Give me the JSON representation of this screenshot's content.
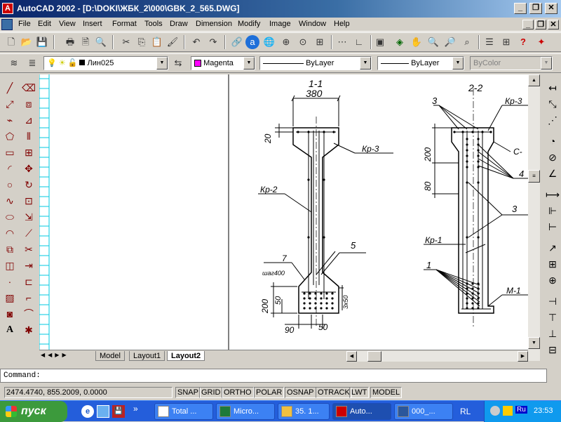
{
  "window": {
    "title": "AutoCAD 2002 - [D:\\DOKI\\ЖБК_2\\000\\GBK_2_565.DWG]",
    "min": "_",
    "restore": "❐",
    "close": "✕"
  },
  "menu": [
    "File",
    "Edit",
    "View",
    "Insert",
    "Format",
    "Tools",
    "Draw",
    "Dimension",
    "Modify",
    "Image",
    "Window",
    "Help"
  ],
  "props": {
    "layer": "Лин025",
    "color": "Magenta",
    "color_hex": "#ff00ff",
    "linetype": "ByLayer",
    "lineweight": "ByLayer",
    "plotstyle": "ByColor"
  },
  "tabs": [
    "Model",
    "Layout1",
    "Layout2"
  ],
  "active_tab": "Layout2",
  "command": "Command:",
  "coords": "2474.4740, 855.2009, 0.0000",
  "status_buttons": [
    "SNAP",
    "GRID",
    "ORTHO",
    "POLAR",
    "OSNAP",
    "OTRACK",
    "LWT",
    "MODEL"
  ],
  "drawing": {
    "sec1": {
      "title": "1-1",
      "dims": [
        "380",
        "20",
        "90",
        "50",
        "200",
        "50",
        "3x50"
      ],
      "labels": [
        "Кр-3",
        "Кр-2",
        "7",
        "5",
        "шаг400"
      ]
    },
    "sec2": {
      "title": "2-2",
      "dims": [
        "200",
        "80"
      ],
      "labels": [
        "3",
        "Кр-3",
        "С-",
        "4",
        "3",
        "Кр-1",
        "1",
        "М-1"
      ]
    }
  },
  "taskbar": {
    "start": "пуск",
    "tasks": [
      "Total ...",
      "Micro...",
      "35. 1...",
      "Auto...",
      "000_..."
    ],
    "lang_rl": "RL",
    "lang": "Ru",
    "clock": "23:53"
  }
}
